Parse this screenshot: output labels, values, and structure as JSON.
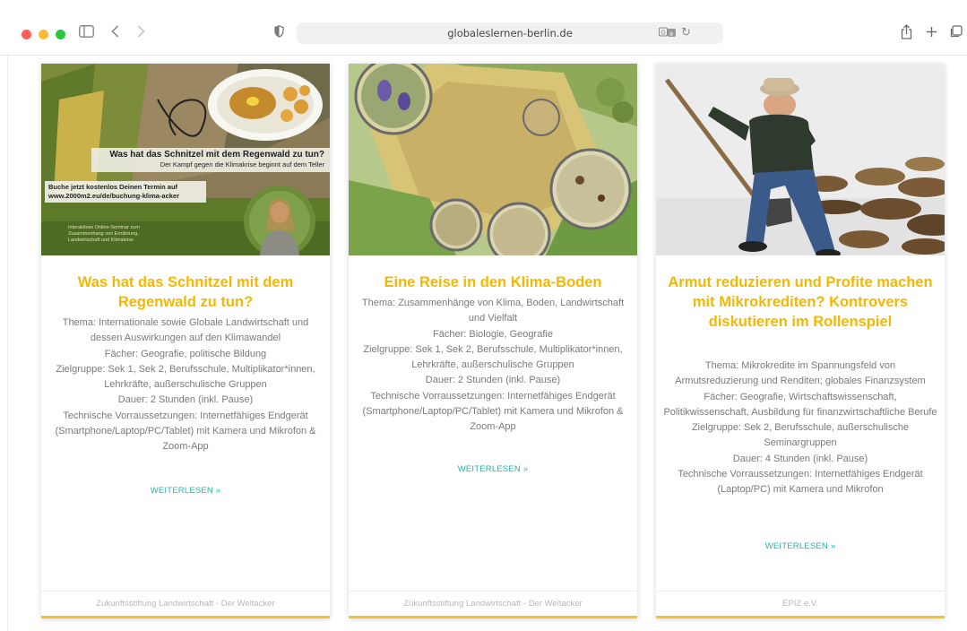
{
  "browser": {
    "url": "globaleslernen-berlin.de"
  },
  "cards": [
    {
      "image_text": {
        "headline": "Was hat das Schnitzel mit dem Regenwald zu tun?",
        "subline": "Der Kampf gegen die Klimakrise beginnt auf dem Teller",
        "booking_line1": "Buche jetzt kostenlos Deinen Termin auf",
        "booking_line2": "www.2000m2.eu/de/buchung-klima-acker",
        "seminar_line1": "Interaktives Online-Seminar zum",
        "seminar_line2": "Zusammenhang von Ernährung,",
        "seminar_line3": "Landwirtschaft und Klimakrise"
      },
      "title": "Was hat das Schnitzel mit dem Regenwald zu tun?",
      "lines": [
        "Thema: Internationale sowie Globale Landwirtschaft und dessen Auswirkungen auf den Klimawandel",
        "Fächer: Geografie, politische Bildung",
        "Zielgruppe: Sek 1, Sek 2, Berufsschule, Multiplikator*innen, Lehrkräfte, außerschulische Gruppen",
        "Dauer: 2 Stunden (inkl. Pause)",
        "Technische Vorraussetzungen: Internetfähiges Endgerät (Smartphone/Laptop/PC/Tablet) mit Kamera und Mikrofon & Zoom-App"
      ],
      "more": "WEITERLESEN »",
      "footer": "Zukunftsstiftung Landwirtschaft - Der Weltacker"
    },
    {
      "title": "Eine Reise in den Klima-Boden",
      "lines": [
        "Thema: Zusammenhänge von Klima, Boden, Landwirtschaft und Vielfalt",
        "Fächer: Biologie, Geografie",
        "Zielgruppe: Sek 1, Sek 2, Berufsschule, Multiplikator*innen, Lehrkräfte, außerschulische Gruppen",
        "Dauer: 2 Stunden (inkl. Pause)",
        "Technische Vorraussetzungen: Internetfähiges Endgerät (Smartphone/Laptop/PC/Tablet) mit Kamera und Mikrofon & Zoom-App"
      ],
      "more": "WEITERLESEN »",
      "footer": "Zukunftsstiftung Landwirtschaft - Der Weltacker"
    },
    {
      "title": "Armut reduzieren und Profite machen mit Mikrokrediten? Kontrovers diskutieren im Rollenspiel",
      "lines": [
        "Thema: Mikrokredite im Spannungsfeld von Armutsreduzierung und Renditen; globales Finanzsystem",
        "Fächer: Geografie, Wirtschaftswissenschaft, Politikwissenschaft, Ausbildung für finanzwirtschaftliche Berufe",
        "Zielgruppe: Sek 2, Berufsschule, außerschulische Seminargruppen",
        "Dauer: 4 Stunden (inkl. Pause)",
        "Technische Vorraussetzungen: Internetfähiges Endgerät (Laptop/PC) mit Kamera und Mikrofon"
      ],
      "more": "WEITERLESEN »",
      "footer": "EPIZ e.V."
    }
  ],
  "colors": {
    "title": "#f5b800",
    "link": "#2bb3a6",
    "card_border": "#f2c42b"
  }
}
